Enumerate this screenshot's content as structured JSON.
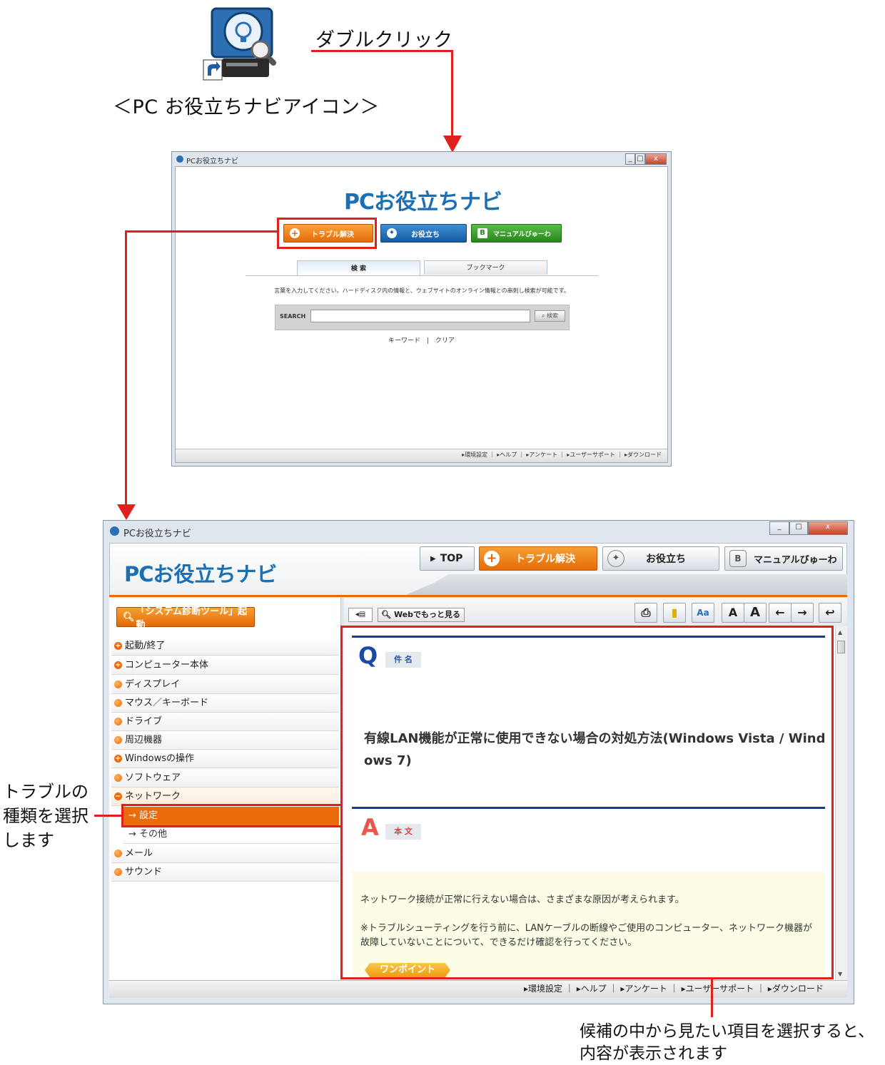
{
  "annotations": {
    "double_click": "ダブルクリック",
    "icon_caption": "＜PC お役立ちナビアイコン＞",
    "select_trouble_type": [
      "トラブルの",
      "種類を選択",
      "します"
    ],
    "select_item": [
      "候補の中から見たい項目を選択すると、",
      "内容が表示されます"
    ]
  },
  "small_window": {
    "title": "PCお役立ちナビ",
    "logo_pc": "PC",
    "logo_rest": "お役立ちナビ",
    "buttons": [
      "トラブル解決",
      "お役立ち",
      "マニュアルびゅーわ"
    ],
    "tabs": [
      "検 索",
      "ブックマーク"
    ],
    "instructions": "言葉を入力してください。ハードディスク内の情報と、ウェブサイトのオンライン情報との串刺し検索が可能です。",
    "search_label": "SEARCH",
    "search_button": "検索",
    "links": [
      "キーワード",
      "|",
      "クリア"
    ],
    "footer": [
      "環境設定",
      "ヘルプ",
      "アンケート",
      "ユーザーサポート",
      "ダウンロード"
    ]
  },
  "large_window": {
    "title": "PCお役立ちナビ",
    "logo_pc": "PC",
    "logo_rest": "お役立ちナビ",
    "nav": [
      "TOP",
      "トラブル解決",
      "お役立ち",
      "マニュアルびゅーわ"
    ],
    "diag_button": "「システム診断ツール」起動",
    "web_more": "Webでもっと見る",
    "sidebar": [
      {
        "label": "起動/終了",
        "marker": "plus"
      },
      {
        "label": "コンピューター本体",
        "marker": "plus"
      },
      {
        "label": "ディスプレイ",
        "marker": "dot"
      },
      {
        "label": "マウス／キーボード",
        "marker": "dot"
      },
      {
        "label": "ドライブ",
        "marker": "dot"
      },
      {
        "label": "周辺機器",
        "marker": "dot"
      },
      {
        "label": "Windowsの操作",
        "marker": "plus"
      },
      {
        "label": "ソフトウェア",
        "marker": "dot"
      },
      {
        "label": "ネットワーク",
        "marker": "minus"
      }
    ],
    "sub_items": [
      "→ 設定",
      "→ その他"
    ],
    "sidebar_after": [
      "メール",
      "サウンド"
    ],
    "q_letter": "Q",
    "q_badge": "件 名",
    "question": "有線LAN機能が正常に使用できない場合の対処方法(Windows Vista / Windows 7)",
    "a_letter": "A",
    "a_badge": "本 文",
    "answer_p1": "ネットワーク接続が正常に行えない場合は、さまざまな原因が考えられます。",
    "answer_p2": "※トラブルシューティングを行う前に、LANケーブルの断線やご使用のコンピューター、ネットワーク機器が故障していないことについて、できるだけ確認を行ってください。",
    "onepoint": "ワンポイント",
    "footer": [
      "環境設定",
      "ヘルプ",
      "アンケート",
      "ユーザーサポート",
      "ダウンロード"
    ],
    "colors": {
      "accent_orange": "#e96b0b",
      "brand_blue": "#1b6fb4",
      "annotation_red": "#e0201c"
    }
  }
}
